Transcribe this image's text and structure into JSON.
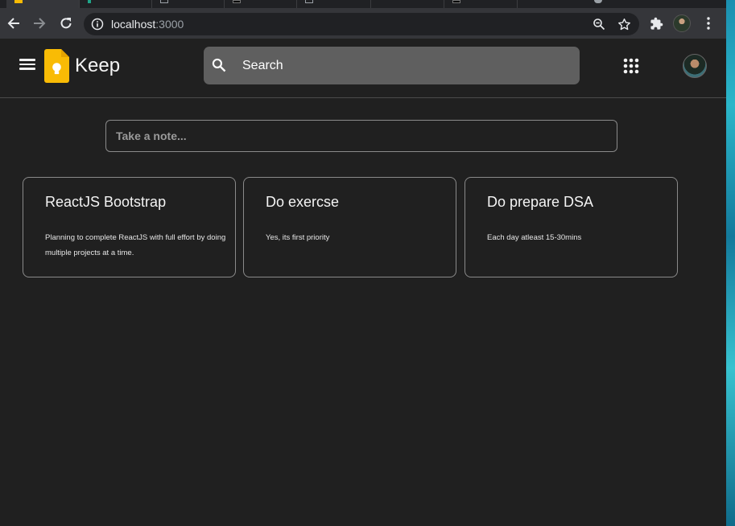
{
  "browser": {
    "url_host": "localhost",
    "url_port": ":3000",
    "icons": [
      "back-icon",
      "forward-icon",
      "reload-icon",
      "info-icon",
      "zoom-icon",
      "star-icon",
      "extensions-icon",
      "menu-icon"
    ]
  },
  "app": {
    "title": "Keep",
    "search_label": "Search",
    "take_note_placeholder": "Take a note...",
    "colors": {
      "background": "#202020",
      "search_bg": "#5f5f5f",
      "logo": "#f9bb05",
      "card_border": "#8a8a8a"
    }
  },
  "notes": [
    {
      "title": "ReactJS Bootstrap",
      "body": "Planning to complete ReactJS with full effort by doing multiple projects at a time."
    },
    {
      "title": "Do exercse",
      "body": "Yes, its first priority"
    },
    {
      "title": "Do prepare DSA",
      "body": "Each day atleast 15-30mins"
    }
  ]
}
